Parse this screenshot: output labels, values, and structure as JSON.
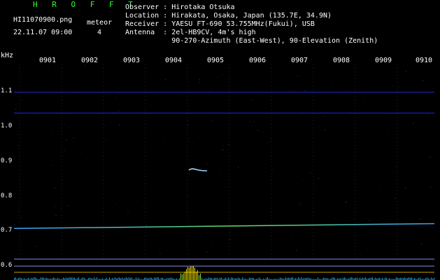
{
  "header": {
    "brand": "H R O F F T",
    "filename": "HI11070900.png",
    "datetime": "22.11.07 09:00",
    "meteor_label": "meteor",
    "meteor_count": "4",
    "observer_line": "Observer : Hirotaka Otsuka",
    "location_line": "Location : Hirakata, Osaka, Japan (135.7E, 34.9N)",
    "receiver_line": "Receiver : YAESU FT-690 53.755MHz(Fukui), USB",
    "antenna_line": "Antenna  : 2el-HB9CV, 4m's high",
    "antenna_line2": "           90-270-Azimuth (East-West), 90-Elevation (Zenith)"
  },
  "axis": {
    "y_unit": "kHz",
    "y_ticks": [
      "1.1",
      "1.0",
      "0.9",
      "0.8",
      "0.7",
      "0.6"
    ],
    "x_ticks": [
      "0901",
      "0902",
      "0903",
      "0904",
      "0905",
      "0906",
      "0907",
      "0908",
      "0909",
      "0910"
    ]
  },
  "spectrogram": {
    "y_range_khz": [
      0.58,
      1.18
    ],
    "carrier_lines_khz": [
      1.1,
      1.04
    ],
    "reference_lines_khz": [
      0.62,
      0.6
    ],
    "signal_line_khz": [
      0.708,
      0.722
    ],
    "meteor_trace": {
      "time_min": 4.5,
      "freq_khz": 0.876
    },
    "colors": {
      "background": "#000000",
      "grid_dots": "#20204a",
      "carrier": "#1a2ad8",
      "signal": "#3aa0ff",
      "signal_end": "#60e060",
      "reference_line": "#8a8ae0",
      "bottom_line": "#c8a000",
      "meteor": "#9fd8ff"
    }
  }
}
